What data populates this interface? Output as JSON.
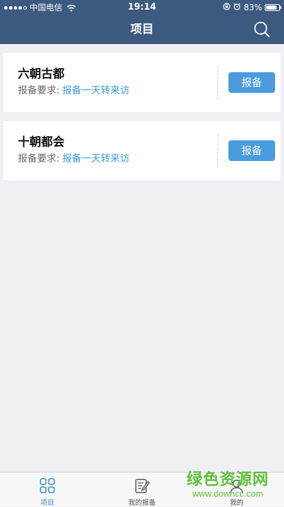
{
  "status_bar": {
    "carrier": "中国电信",
    "time": "19:14",
    "battery": "83%",
    "battery_level": 0.83
  },
  "header": {
    "title": "项目",
    "background": "#3c5a7f",
    "search_icon": "search-icon"
  },
  "projects": [
    {
      "name": "六朝古都",
      "req_label": "报备要求:",
      "req_value": "报备一天转来访",
      "button_label": "报备"
    },
    {
      "name": "十朝都会",
      "req_label": "报备要求:",
      "req_value": "报备一天转来访",
      "button_label": "报备"
    }
  ],
  "tabbar": {
    "tabs": [
      {
        "label": "项目",
        "icon": "grid-icon",
        "active": true
      },
      {
        "label": "我的报备",
        "icon": "edit-icon",
        "active": false
      },
      {
        "label": "我的",
        "icon": "user-icon",
        "active": false
      }
    ]
  },
  "watermark": {
    "brand": "绿色资源网",
    "url": "www.downcc.com"
  },
  "colors": {
    "accent": "#4a9bde",
    "link": "#3d9ad6",
    "page_bg": "#efeff4",
    "watermark": "#5cc23a"
  }
}
